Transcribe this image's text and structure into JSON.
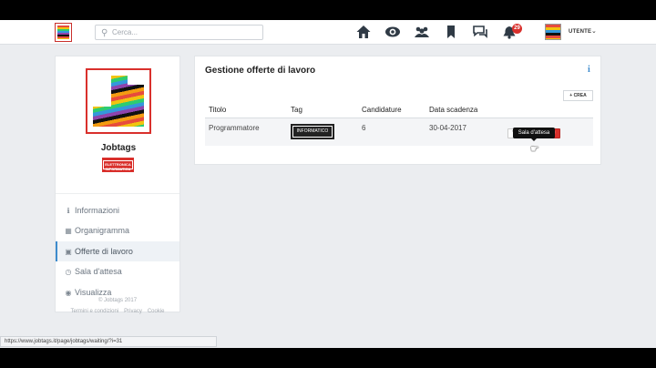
{
  "header": {
    "search_placeholder": "Cerca...",
    "notification_count": "29",
    "user_label": "UTENTE",
    "nav_icons": [
      "home-icon",
      "eye-icon",
      "people-icon",
      "bookmark-icon",
      "chat-icon",
      "bell-icon"
    ]
  },
  "sidebar": {
    "company_name": "Jobtags",
    "company_tag": "ELETTRONICA INFORMATICA",
    "items": [
      {
        "label": "Informazioni",
        "icon": "info-icon"
      },
      {
        "label": "Organigramma",
        "icon": "sitemap-icon"
      },
      {
        "label": "Offerte di lavoro",
        "icon": "briefcase-icon"
      },
      {
        "label": "Sala d'attesa",
        "icon": "clock-icon"
      },
      {
        "label": "Visualizza",
        "icon": "eye-icon"
      }
    ]
  },
  "footer": {
    "copyright": "© Jobtags 2017",
    "links": [
      "Termini e condizioni",
      "Privacy",
      "Cookie"
    ]
  },
  "main": {
    "title": "Gestione offerte di lavoro",
    "create_label": "CREA",
    "columns": [
      "Titolo",
      "Tag",
      "Candidature",
      "Data scadenza"
    ],
    "rows": [
      {
        "titolo": "Programmatore",
        "tag": "INFORMATICO",
        "candidature": "6",
        "scadenza": "30-04-2017"
      }
    ],
    "tooltip": "Sala d'attesa"
  },
  "status_url": "https://www.jobtags.it/page/jobtags/waiting/?i=31",
  "colors": {
    "accent": "#3d8bcd",
    "danger": "#d9302c",
    "success": "#3aa84a"
  }
}
